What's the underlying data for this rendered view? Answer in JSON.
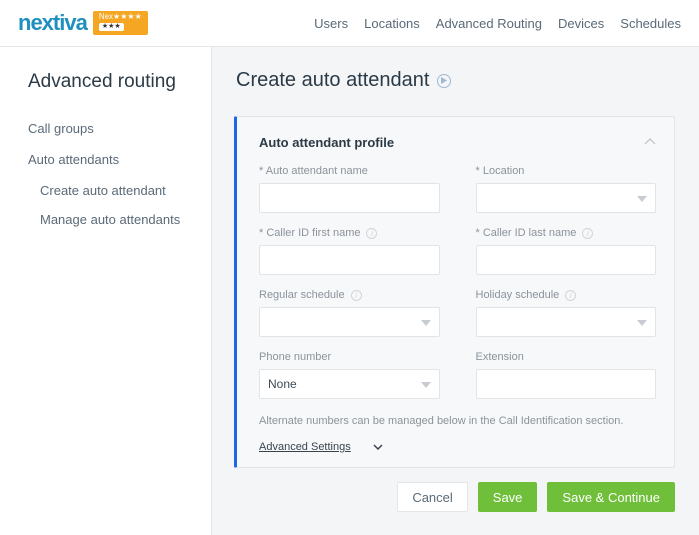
{
  "brand": {
    "name": "nextiva",
    "badge_top": "Nex★★★★",
    "badge_sub": "★★★"
  },
  "nav": [
    "Users",
    "Locations",
    "Advanced Routing",
    "Devices",
    "Schedules"
  ],
  "sidebar": {
    "title": "Advanced routing",
    "items": [
      {
        "label": "Call groups"
      },
      {
        "label": "Auto attendants",
        "children": [
          {
            "label": "Create auto attendant"
          },
          {
            "label": "Manage auto attendants"
          }
        ]
      }
    ]
  },
  "page": {
    "title": "Create auto attendant"
  },
  "panel": {
    "title": "Auto attendant profile",
    "fields": {
      "name": {
        "label": "* Auto attendant name",
        "value": ""
      },
      "location": {
        "label": "* Location",
        "value": ""
      },
      "cid_first": {
        "label": "* Caller ID first name",
        "value": ""
      },
      "cid_last": {
        "label": "* Caller ID last name",
        "value": ""
      },
      "reg_sched": {
        "label": "Regular schedule",
        "value": ""
      },
      "hol_sched": {
        "label": "Holiday schedule",
        "value": ""
      },
      "phone": {
        "label": "Phone number",
        "value": "None"
      },
      "ext": {
        "label": "Extension",
        "value": ""
      }
    },
    "note": "Alternate numbers can be managed below in the Call Identification section.",
    "advanced": "Advanced Settings"
  },
  "actions": {
    "cancel": "Cancel",
    "save": "Save",
    "save_cont": "Save & Continue"
  }
}
